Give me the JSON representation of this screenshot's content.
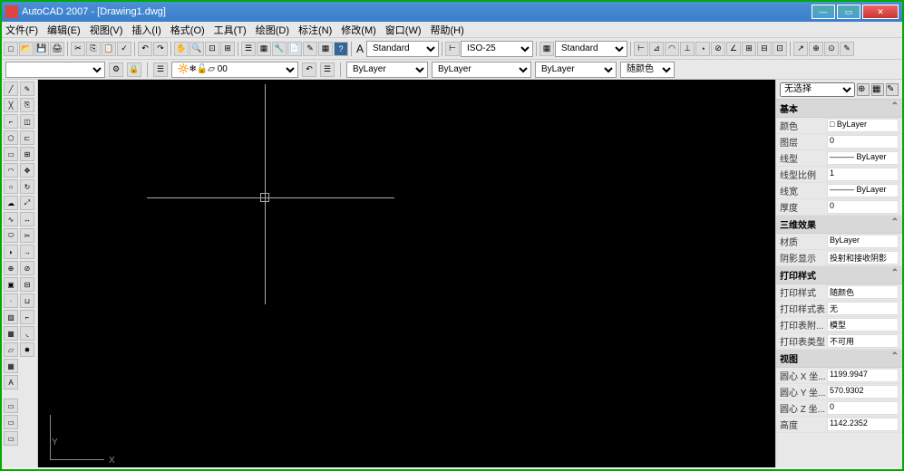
{
  "title": "AutoCAD 2007 - [Drawing1.dwg]",
  "menu": [
    "文件(F)",
    "编辑(E)",
    "视图(V)",
    "插入(I)",
    "格式(O)",
    "工具(T)",
    "绘图(D)",
    "标注(N)",
    "修改(M)",
    "窗口(W)",
    "帮助(H)"
  ],
  "toolbar1": {
    "text_style": "Standard",
    "dim_style": "ISO-25",
    "table_style": "Standard"
  },
  "toolbar2": {
    "layer_combo": "0",
    "color": "ByLayer",
    "linetype": "ByLayer",
    "lineweight": "ByLayer",
    "plotstyle": "随颜色"
  },
  "props": {
    "selector": "无选择",
    "sections": {
      "basic": {
        "title": "基本",
        "rows": [
          {
            "label": "颜色",
            "value": "□ ByLayer"
          },
          {
            "label": "图层",
            "value": "0"
          },
          {
            "label": "线型",
            "value": "——— ByLayer"
          },
          {
            "label": "线型比例",
            "value": "1"
          },
          {
            "label": "线宽",
            "value": "——— ByLayer"
          },
          {
            "label": "厚度",
            "value": "0"
          }
        ]
      },
      "threed": {
        "title": "三维效果",
        "rows": [
          {
            "label": "材质",
            "value": "ByLayer"
          },
          {
            "label": "阴影显示",
            "value": "投射和接收阴影"
          }
        ]
      },
      "plot": {
        "title": "打印样式",
        "rows": [
          {
            "label": "打印样式",
            "value": "随颜色"
          },
          {
            "label": "打印样式表",
            "value": "无"
          },
          {
            "label": "打印表附...",
            "value": "模型"
          },
          {
            "label": "打印表类型",
            "value": "不可用"
          }
        ]
      },
      "view": {
        "title": "视图",
        "rows": [
          {
            "label": "圆心 X 坐...",
            "value": "1199.9947"
          },
          {
            "label": "圆心 Y 坐...",
            "value": "570.9302"
          },
          {
            "label": "圆心 Z 坐...",
            "value": "0"
          },
          {
            "label": "高度",
            "value": "1142.2352"
          }
        ]
      }
    }
  },
  "ucs": {
    "x": "X",
    "y": "Y"
  }
}
